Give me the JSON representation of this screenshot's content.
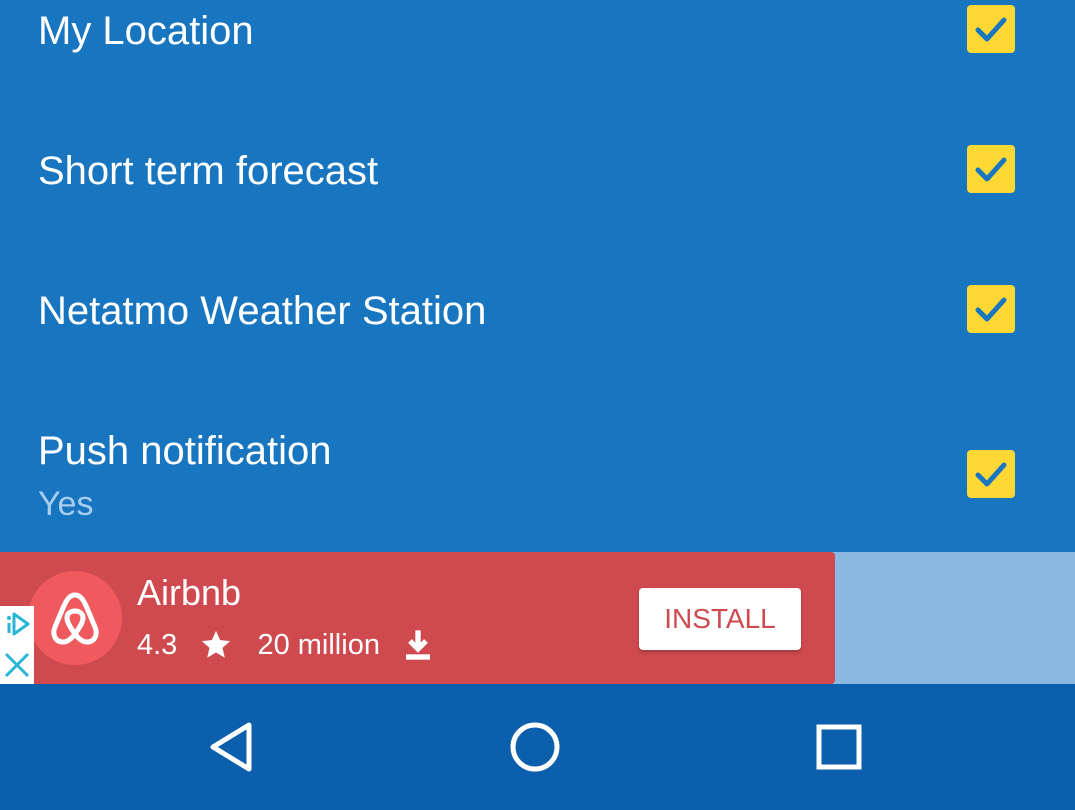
{
  "settings": {
    "items": [
      {
        "label": "My Location",
        "checked": true
      },
      {
        "label": "Short term forecast",
        "checked": true
      },
      {
        "label": "Netatmo Weather Station",
        "checked": true
      },
      {
        "label": "Push notification",
        "summary": "Yes",
        "checked": true
      }
    ]
  },
  "ad": {
    "app_name": "Airbnb",
    "rating": "4.3",
    "downloads": "20 million",
    "install_label": "INSTALL",
    "colors": {
      "card": "#cf4a4f",
      "background": "#8bb8e2",
      "logo": "#f05a5e"
    },
    "icons": [
      "airbnb-logo-icon",
      "star-icon",
      "download-icon",
      "adchoices-icon",
      "close-icon"
    ]
  },
  "navbar": {
    "icons": [
      "back-icon",
      "home-icon",
      "recents-icon"
    ]
  },
  "colors": {
    "background": "#1875c0",
    "checkbox": "#fdd835",
    "navbar": "#0c5fad"
  }
}
